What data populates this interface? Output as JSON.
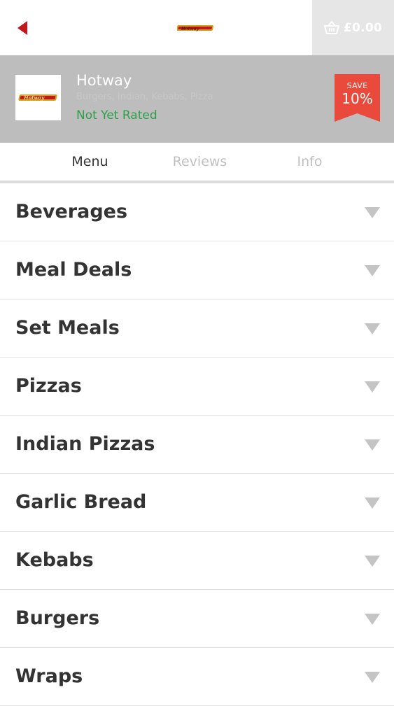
{
  "topbar": {
    "back_icon": "back-arrow-icon",
    "logo_text": "Hotway",
    "basket_icon": "basket-icon",
    "basket_total": "£0.00",
    "accent_color": "#c0181e"
  },
  "restaurant": {
    "name": "Hotway",
    "cuisines": "Burgers, Indian, Kebabs, Pizza",
    "rating": "Not Yet Rated",
    "logo_text": "Hotway",
    "discount": {
      "label": "SAVE",
      "value": "10%",
      "color": "#ea4a3b"
    }
  },
  "tabs": [
    {
      "label": "Menu",
      "active": true
    },
    {
      "label": "Reviews",
      "active": false
    },
    {
      "label": "Info",
      "active": false
    }
  ],
  "categories": [
    {
      "label": "Beverages"
    },
    {
      "label": "Meal Deals"
    },
    {
      "label": "Set Meals"
    },
    {
      "label": "Pizzas"
    },
    {
      "label": "Indian Pizzas"
    },
    {
      "label": "Garlic Bread"
    },
    {
      "label": "Kebabs"
    },
    {
      "label": "Burgers"
    },
    {
      "label": "Wraps"
    }
  ],
  "category_arrow_icon": "chevron-down-icon"
}
